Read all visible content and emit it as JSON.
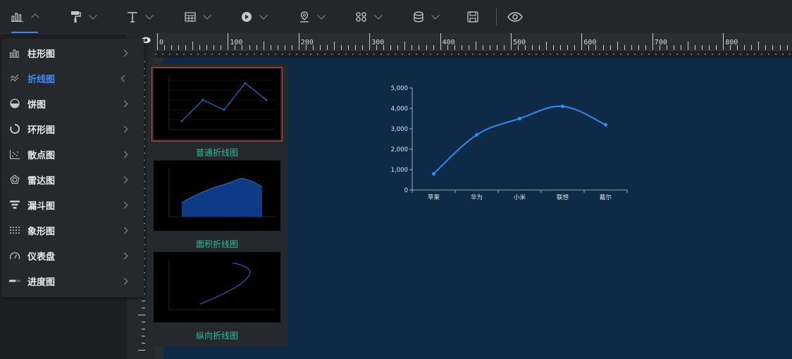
{
  "toolbar": {
    "items": [
      {
        "icon": "bar-chart-icon",
        "active": true
      },
      {
        "icon": "paint-roller-icon"
      },
      {
        "icon": "text-icon"
      },
      {
        "icon": "table-icon"
      },
      {
        "icon": "media-play-icon"
      },
      {
        "icon": "map-pin-icon"
      },
      {
        "icon": "components-icon"
      },
      {
        "icon": "database-icon"
      },
      {
        "icon": "save-icon"
      },
      {
        "icon": "preview-eye-icon"
      }
    ]
  },
  "ruler": {
    "labels": [
      "0",
      "100",
      "200",
      "300",
      "400",
      "500",
      "600",
      "700",
      "800"
    ]
  },
  "menu": {
    "items": [
      {
        "label": "柱形图",
        "icon": "bar-chart-icon"
      },
      {
        "label": "折线图",
        "icon": "line-chart-icon",
        "active": true
      },
      {
        "label": "饼图",
        "icon": "pie-chart-icon"
      },
      {
        "label": "环形图",
        "icon": "ring-chart-icon"
      },
      {
        "label": "散点图",
        "icon": "scatter-chart-icon"
      },
      {
        "label": "雷达图",
        "icon": "radar-chart-icon"
      },
      {
        "label": "漏斗图",
        "icon": "funnel-chart-icon"
      },
      {
        "label": "象形图",
        "icon": "pictorial-chart-icon"
      },
      {
        "label": "仪表盘",
        "icon": "gauge-icon"
      },
      {
        "label": "进度图",
        "icon": "progress-icon"
      }
    ]
  },
  "submenu": {
    "items": [
      {
        "label": "普通折线图",
        "selected": true
      },
      {
        "label": "面积折线图"
      },
      {
        "label": "纵向折线图"
      }
    ]
  },
  "chart_data": {
    "type": "line",
    "categories": [
      "苹果",
      "华为",
      "小米",
      "联想",
      "戴尔"
    ],
    "values": [
      800,
      2700,
      3500,
      4100,
      3200
    ],
    "ylim": [
      0,
      5000
    ],
    "yticks": [
      "0",
      "1,000",
      "2,000",
      "3,000",
      "4,000",
      "5,000"
    ],
    "smooth": true,
    "color": "#2d8cf0",
    "title": "",
    "xlabel": "",
    "ylabel": ""
  },
  "colors": {
    "accent": "#3b8cf5",
    "canvas": "#0e2a47",
    "submenu_label": "#2fbf9e"
  }
}
